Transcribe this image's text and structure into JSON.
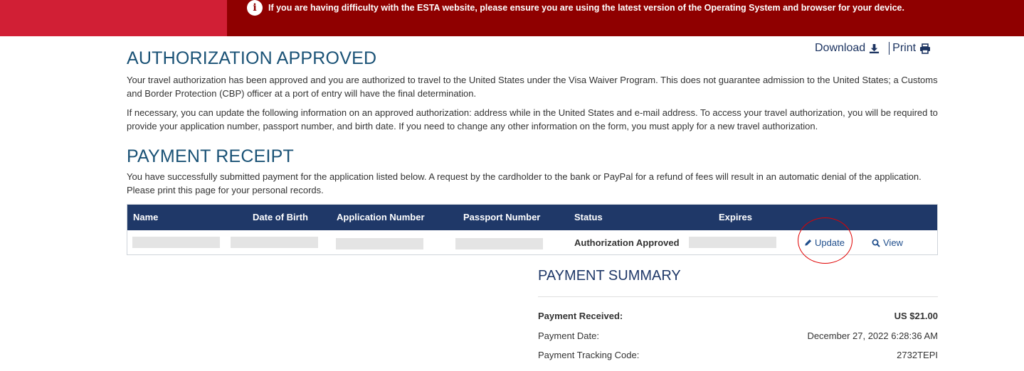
{
  "banner": {
    "info_icon": "info-circle-icon",
    "message": "If you are having difficulty with the ESTA website, please ensure you are using the latest version of the Operating System and browser for your device.",
    "colors": {
      "left": "#d11f35",
      "right": "#8f0000"
    }
  },
  "toolbar": {
    "download_label": "Download",
    "download_icon": "download-icon",
    "print_label": "Print",
    "print_icon": "printer-icon"
  },
  "authorization": {
    "title": "AUTHORIZATION APPROVED",
    "para1": "Your travel authorization has been approved and you are authorized to travel to the United States under the Visa Waiver Program. This does not guarantee admission to the United States; a Customs and Border Protection (CBP) officer at a port of entry will have the final determination.",
    "para2": "If necessary, you can update the following information on an approved authorization: address while in the United States and e-mail address. To access your travel authorization, you will be required to provide your application number, passport number, and birth date. If you need to change any other information on the form, you must apply for a new travel authorization."
  },
  "receipt": {
    "title": "PAYMENT RECEIPT",
    "para": "You have successfully submitted payment for the application listed below. A request by the cardholder to the bank or PayPal for a refund of fees will result in an automatic denial of the application. Please print this page for your personal records."
  },
  "table": {
    "headers": [
      "Name",
      "Date of Birth",
      "Application Number",
      "Passport Number",
      "Status",
      "Expires"
    ],
    "row": {
      "status": "Authorization Approved",
      "update_label": "Update",
      "update_icon": "pencil-icon",
      "view_label": "View",
      "view_icon": "search-icon"
    },
    "header_color": "#1f3868"
  },
  "payment_summary": {
    "title": "PAYMENT SUMMARY",
    "rows": [
      {
        "label": "Payment Received:",
        "value": "US $21.00"
      },
      {
        "label": "Payment Date:",
        "value": "December 27, 2022 6:28:36 AM"
      },
      {
        "label": "Payment Tracking Code:",
        "value": "2732TEPI"
      }
    ]
  }
}
